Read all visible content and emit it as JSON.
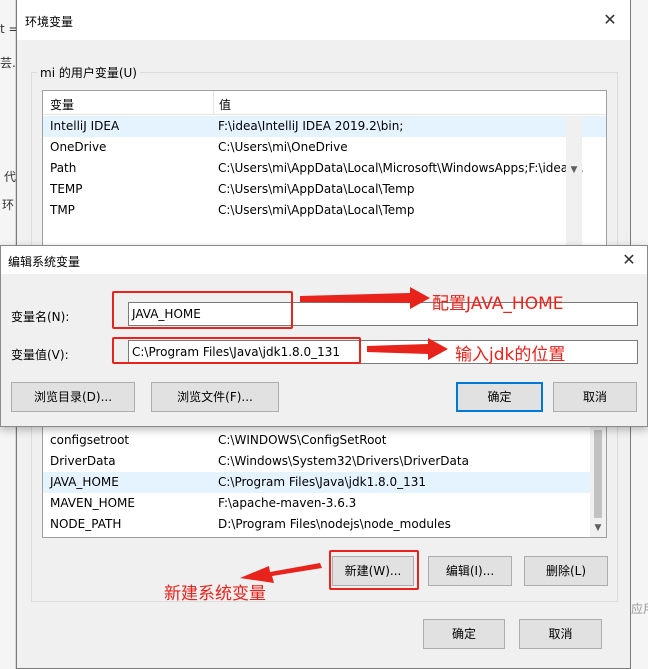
{
  "background": {
    "left_fragments": [
      "t =",
      "芸.",
      "代",
      "环"
    ],
    "right_fragment": "应用"
  },
  "env_window": {
    "title": "环境变量",
    "close_glyph": "✕",
    "user_group_label": "mi 的用户变量(U)",
    "columns": [
      "变量",
      "值"
    ],
    "user_rows": [
      {
        "name": "IntelliJ IDEA",
        "value": "F:\\idea\\IntelliJ IDEA 2019.2\\bin;"
      },
      {
        "name": "OneDrive",
        "value": "C:\\Users\\mi\\OneDrive"
      },
      {
        "name": "Path",
        "value": "C:\\Users\\mi\\AppData\\Local\\Microsoft\\WindowsApps;F:\\idea\\..."
      },
      {
        "name": "TEMP",
        "value": "C:\\Users\\mi\\AppData\\Local\\Temp"
      },
      {
        "name": "TMP",
        "value": "C:\\Users\\mi\\AppData\\Local\\Temp"
      }
    ],
    "system_rows": [
      {
        "name": "configsetroot",
        "value": "C:\\WINDOWS\\ConfigSetRoot"
      },
      {
        "name": "DriverData",
        "value": "C:\\Windows\\System32\\Drivers\\DriverData"
      },
      {
        "name": "JAVA_HOME",
        "value": "C:\\Program Files\\Java\\jdk1.8.0_131"
      },
      {
        "name": "MAVEN_HOME",
        "value": "F:\\apache-maven-3.6.3"
      },
      {
        "name": "NODE_PATH",
        "value": "D:\\Program Files\\nodejs\\node_modules"
      }
    ],
    "system_buttons": {
      "new": "新建(W)...",
      "edit": "编辑(I)...",
      "delete": "删除(L)"
    },
    "footer_buttons": {
      "ok": "确定",
      "cancel": "取消"
    }
  },
  "edit_dialog": {
    "title": "编辑系统变量",
    "close_glyph": "✕",
    "name_label": "变量名(N):",
    "name_value": "JAVA_HOME",
    "value_label": "变量值(V):",
    "value_value": "C:\\Program Files\\Java\\jdk1.8.0_131",
    "buttons": {
      "browse_dir": "浏览目录(D)...",
      "browse_file": "浏览文件(F)...",
      "ok": "确定",
      "cancel": "取消"
    }
  },
  "annotations": {
    "configure": "配置JAVA_HOME",
    "input_jdk": "输入jdk的位置",
    "new_system_var": "新建系统变量",
    "annotation_color": "#e8231c"
  }
}
